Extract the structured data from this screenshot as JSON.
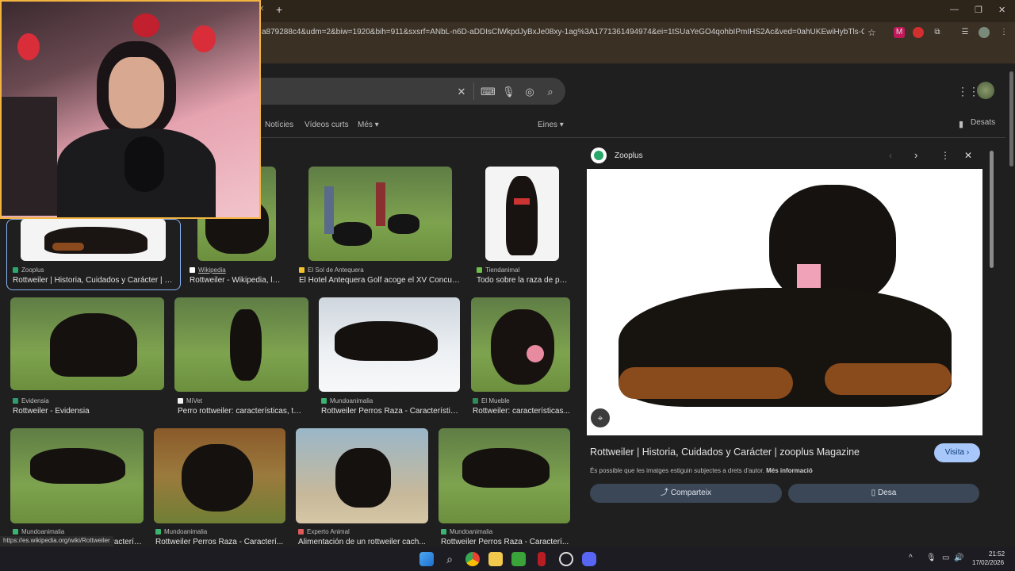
{
  "browser": {
    "new_tab_symbol": "+",
    "url": "a879288c4&udm=2&biw=1920&bih=911&sxsrf=ANbL-n6D-aDDIsClWkpdJyBxJe08xy-1ag%3A1771361494974&ei=1tSUaYeGO4qohbIPmIHS2Ac&ved=0ahUKEwiHybTls-GSAxUKVEE...",
    "minimize": "—",
    "restore": "❐",
    "close": "✕",
    "status_url": "https://es.wikipedia.org/wiki/Rottweiler"
  },
  "header": {
    "tabs": [
      "Notícies",
      "Vídeos curts",
      "Més ▾"
    ],
    "tools_label": "Eines ▾",
    "saved_label": "Desats",
    "clear_symbol": "✕"
  },
  "grid": {
    "row1": [
      {
        "source": "Zooplus",
        "title": "Rottweiler | Historia, Cuidados y Carácter | zo...",
        "favicon": "#29a86a"
      },
      {
        "source": "Wikipedia",
        "title": "Rottweiler - Wikipedia, la ...",
        "favicon": "#ffffff"
      },
      {
        "source": "El Sol de Antequera",
        "title": "El Hotel Antequera Golf acoge el XV Concurs...",
        "favicon": "#f2c12e"
      },
      {
        "source": "Tiendanimal",
        "title": "Todo sobre la raza de pe...",
        "favicon": "#6cc04a"
      }
    ],
    "row2": [
      {
        "source": "Evidensia",
        "title": "Rottweiler - Evidensia",
        "favicon": "#2f9c6e"
      },
      {
        "source": "MiVet",
        "title": "Perro rottweiler: características, te...",
        "favicon": "#f2f2f2"
      },
      {
        "source": "Mundoanimalia",
        "title": "Rottweiler Perros Raza - Característic...",
        "favicon": "#3cb371"
      },
      {
        "source": "El Mueble",
        "title": "Rottweiler: características...",
        "favicon": "#2e8b57"
      }
    ],
    "row3": [
      {
        "source": "Mundoanimalia",
        "title": "Rottweiler Perros Raza - Caracterís...",
        "favicon": "#3cb371"
      },
      {
        "source": "Mundoanimalia",
        "title": "Rottweiler Perros Raza - Caracterí...",
        "favicon": "#3cb371"
      },
      {
        "source": "Experto Animal",
        "title": "Alimentación de un rottweiler cach...",
        "favicon": "#e05a5a"
      },
      {
        "source": "Mundoanimalia",
        "title": "Rottweiler Perros Raza - Caracterí...",
        "favicon": "#3cb371"
      }
    ]
  },
  "preview": {
    "source": "Zooplus",
    "title": "Rottweiler | Historia, Cuidados y Carácter | zooplus Magazine",
    "visit_label": "Visita ›",
    "copyright": "És possible que les imatges estiguin subjectes a drets d'autor.",
    "more_info": "Més informació",
    "share_label": "Comparteix",
    "save_label": "Desa",
    "accent": "#a8c7fa"
  },
  "taskbar": {
    "time": "21:52",
    "date": "17/02/2026"
  }
}
